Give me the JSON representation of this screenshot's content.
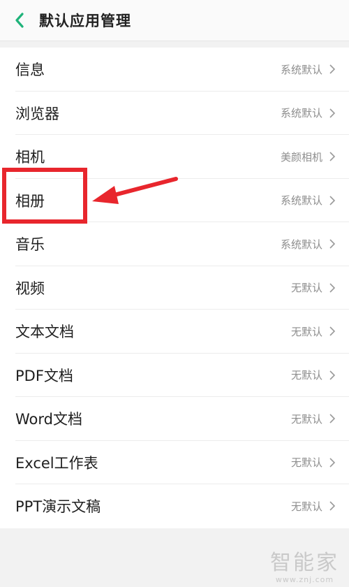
{
  "header": {
    "title": "默认应用管理",
    "back_icon": "chevron-left-icon",
    "accent": "#1fb37a"
  },
  "items": [
    {
      "label": "信息",
      "value": "系统默认"
    },
    {
      "label": "浏览器",
      "value": "系统默认"
    },
    {
      "label": "相机",
      "value": "美颜相机"
    },
    {
      "label": "相册",
      "value": "系统默认"
    },
    {
      "label": "音乐",
      "value": "系统默认"
    },
    {
      "label": "视频",
      "value": "无默认"
    },
    {
      "label": "文本文档",
      "value": "无默认"
    },
    {
      "label": "PDF文档",
      "value": "无默认"
    },
    {
      "label": "Word文档",
      "value": "无默认"
    },
    {
      "label": "Excel工作表",
      "value": "无默认"
    },
    {
      "label": "PPT演示文稿",
      "value": "无默认"
    }
  ],
  "annotation": {
    "color": "#e8262d"
  },
  "watermark": {
    "main": "智能家",
    "sub": "www.znj.com"
  }
}
